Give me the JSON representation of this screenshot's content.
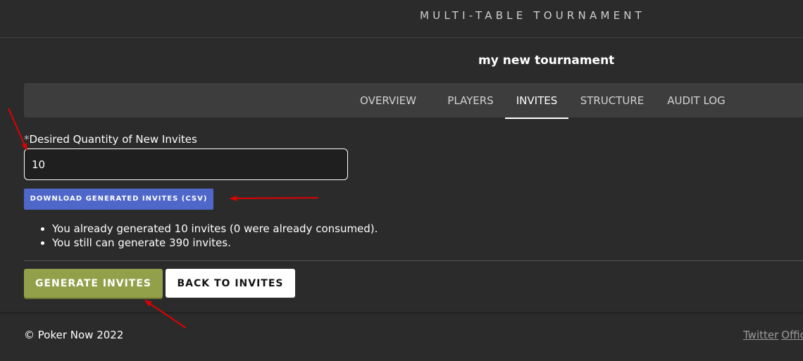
{
  "header": {
    "brand": "MULTI-TABLE TOURNAMENT"
  },
  "tournament": {
    "name": "my new tournament"
  },
  "tabs": [
    {
      "label": "OVERVIEW",
      "active": false
    },
    {
      "label": "PLAYERS",
      "active": false
    },
    {
      "label": "INVITES",
      "active": true
    },
    {
      "label": "STRUCTURE",
      "active": false
    },
    {
      "label": "AUDIT LOG",
      "active": false
    }
  ],
  "form": {
    "required_marker": "*",
    "quantity_label": "Desired Quantity of New Invites",
    "quantity_value": "10",
    "download_csv_label": "DOWNLOAD GENERATED INVITES (CSV)"
  },
  "info": [
    "You already generated 10 invites (0 were already consumed).",
    "You still can generate 390 invites."
  ],
  "actions": {
    "generate_label": "GENERATE INVITES",
    "back_label": "BACK TO INVITES"
  },
  "footer": {
    "copyright": "© Poker Now 2022",
    "links": [
      "Twitter",
      "Offic"
    ]
  },
  "colors": {
    "background": "#2b2b2b",
    "tabbar": "#3d3d3d",
    "csv_button": "#4f67c9",
    "generate_button": "#93a04a",
    "annotation_arrow": "#e00000"
  }
}
